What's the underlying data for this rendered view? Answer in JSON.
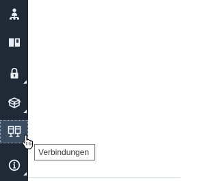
{
  "sidebar": {
    "items": [
      {
        "icon": "hierarchy-user-icon",
        "active": false,
        "has_submenu": false
      },
      {
        "icon": "book-icon",
        "active": false,
        "has_submenu": false
      },
      {
        "icon": "lock-icon",
        "active": false,
        "has_submenu": true
      },
      {
        "icon": "package-icon",
        "active": false,
        "has_submenu": true
      },
      {
        "icon": "connections-icon",
        "active": true,
        "has_submenu": true
      },
      {
        "icon": "info-icon",
        "active": false,
        "has_submenu": true
      }
    ]
  },
  "tooltip": {
    "text": "Verbindungen"
  },
  "colors": {
    "rail_bg": "#1f2a36",
    "rail_active_bg": "#3a4c60",
    "icon": "#e8eef4",
    "canvas": "#ffffff"
  }
}
